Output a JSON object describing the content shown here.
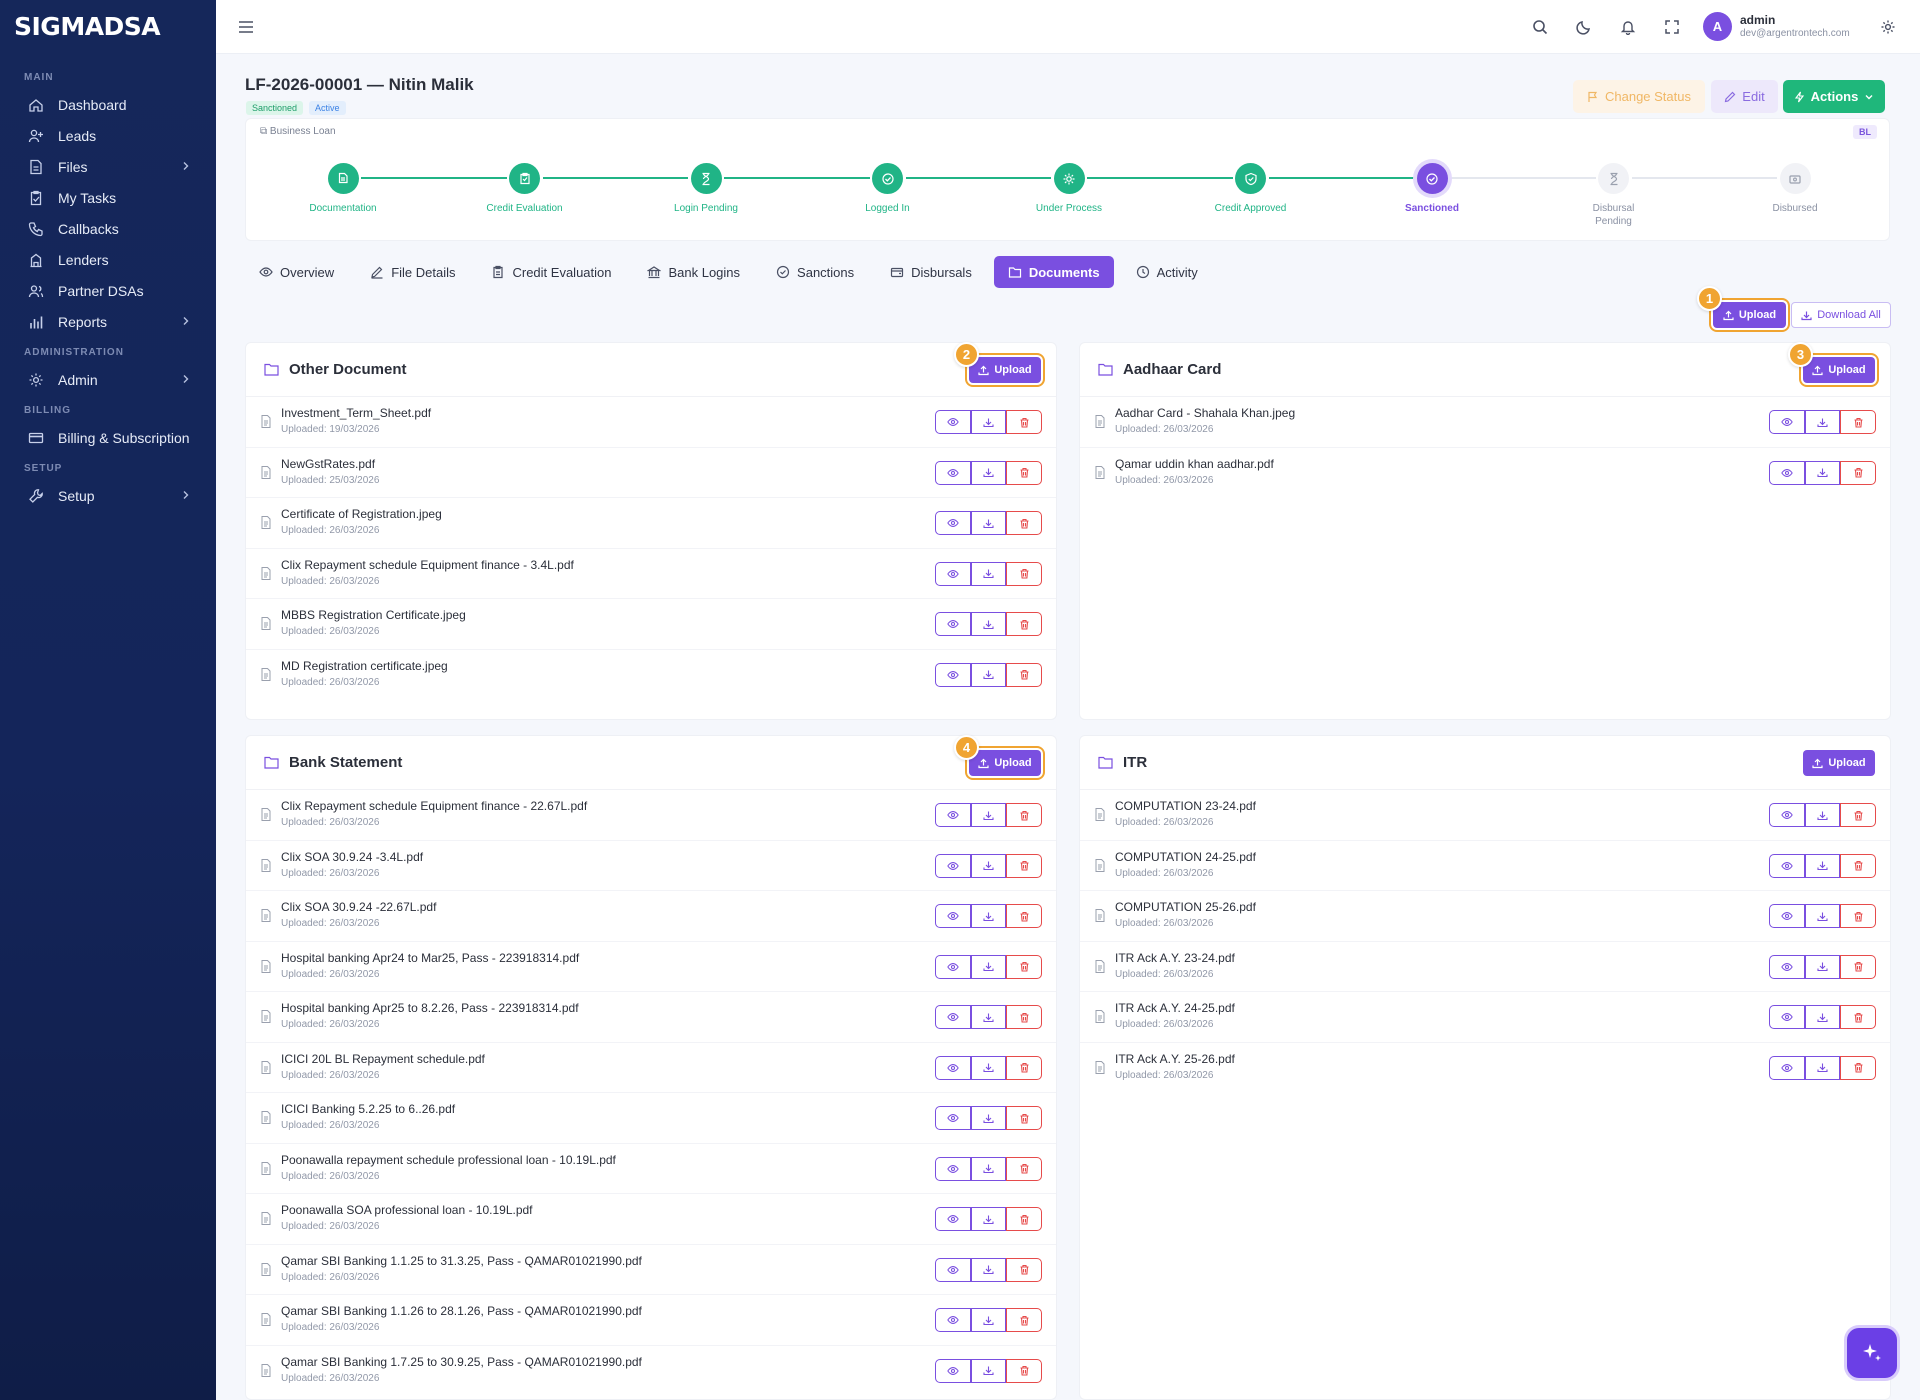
{
  "sidebar": {
    "brand": "SIGMADSA",
    "sections": [
      {
        "title": "MAIN",
        "items": [
          {
            "label": "Dashboard",
            "icon": "home-icon",
            "chevron": false
          },
          {
            "label": "Leads",
            "icon": "user-plus-icon",
            "chevron": false
          },
          {
            "label": "Files",
            "icon": "file-icon",
            "chevron": true
          },
          {
            "label": "My Tasks",
            "icon": "clipboard-check-icon",
            "chevron": false
          },
          {
            "label": "Callbacks",
            "icon": "phone-icon",
            "chevron": false
          },
          {
            "label": "Lenders",
            "icon": "building-icon",
            "chevron": false
          },
          {
            "label": "Partner DSAs",
            "icon": "users-icon",
            "chevron": false
          },
          {
            "label": "Reports",
            "icon": "bar-chart-icon",
            "chevron": true
          }
        ]
      },
      {
        "title": "ADMINISTRATION",
        "items": [
          {
            "label": "Admin",
            "icon": "gear-icon",
            "chevron": true
          }
        ]
      },
      {
        "title": "BILLING",
        "items": [
          {
            "label": "Billing & Subscription",
            "icon": "credit-card-icon",
            "chevron": false
          }
        ]
      },
      {
        "title": "SETUP",
        "items": [
          {
            "label": "Setup",
            "icon": "wrench-icon",
            "chevron": true
          }
        ]
      }
    ]
  },
  "user": {
    "initial": "A",
    "name": "admin",
    "email": "dev@argentrontech.com"
  },
  "header": {
    "title": "LF-2026-00001 — Nitin Malik",
    "status_badge": "Sanctioned",
    "state_badge": "Active",
    "change_status_label": "Change Status",
    "edit_label": "Edit",
    "actions_label": "Actions"
  },
  "loan": {
    "type": "Business Loan",
    "tag": "BL"
  },
  "steps": [
    {
      "label": "Documentation",
      "state": "done"
    },
    {
      "label": "Credit Evaluation",
      "state": "done"
    },
    {
      "label": "Login Pending",
      "state": "done"
    },
    {
      "label": "Logged In",
      "state": "done"
    },
    {
      "label": "Under Process",
      "state": "done"
    },
    {
      "label": "Credit Approved",
      "state": "done"
    },
    {
      "label": "Sanctioned",
      "state": "current"
    },
    {
      "label": "Disbursal Pending",
      "state": "todo"
    },
    {
      "label": "Disbursed",
      "state": "todo"
    }
  ],
  "tabs": [
    {
      "label": "Overview",
      "icon": "eye-icon"
    },
    {
      "label": "File Details",
      "icon": "edit-icon"
    },
    {
      "label": "Credit Evaluation",
      "icon": "clipboard-icon"
    },
    {
      "label": "Bank Logins",
      "icon": "bank-icon"
    },
    {
      "label": "Sanctions",
      "icon": "check-circle-icon"
    },
    {
      "label": "Disbursals",
      "icon": "wallet-icon"
    },
    {
      "label": "Documents",
      "icon": "folder-icon",
      "active": true
    },
    {
      "label": "Activity",
      "icon": "clock-icon"
    }
  ],
  "toolbar": {
    "upload_label": "Upload",
    "download_all_label": "Download All"
  },
  "markers": [
    "1",
    "2",
    "3",
    "4"
  ],
  "colors": {
    "accent": "#7a4fe0",
    "success": "#1fb77b",
    "warning": "#f0a431",
    "danger": "#e64b4b",
    "sidebar": "#15275a"
  },
  "doc_groups": [
    {
      "title": "Other Document",
      "upload_label": "Upload",
      "files": [
        {
          "name": "Investment_Term_Sheet.pdf",
          "date": "Uploaded: 19/03/2026"
        },
        {
          "name": "NewGstRates.pdf",
          "date": "Uploaded: 25/03/2026"
        },
        {
          "name": "Certificate of Registration.jpeg",
          "date": "Uploaded: 26/03/2026"
        },
        {
          "name": "Clix Repayment schedule Equipment finance - 3.4L.pdf",
          "date": "Uploaded: 26/03/2026"
        },
        {
          "name": "MBBS Registration Certificate.jpeg",
          "date": "Uploaded: 26/03/2026"
        },
        {
          "name": "MD Registration certificate.jpeg",
          "date": "Uploaded: 26/03/2026"
        }
      ]
    },
    {
      "title": "Aadhaar Card",
      "upload_label": "Upload",
      "files": [
        {
          "name": "Aadhar Card - Shahala Khan.jpeg",
          "date": "Uploaded: 26/03/2026"
        },
        {
          "name": "Qamar uddin khan aadhar.pdf",
          "date": "Uploaded: 26/03/2026"
        }
      ]
    },
    {
      "title": "Bank Statement",
      "upload_label": "Upload",
      "files": [
        {
          "name": "Clix Repayment schedule Equipment finance - 22.67L.pdf",
          "date": "Uploaded: 26/03/2026"
        },
        {
          "name": "Clix SOA 30.9.24 -3.4L.pdf",
          "date": "Uploaded: 26/03/2026"
        },
        {
          "name": "Clix SOA 30.9.24 -22.67L.pdf",
          "date": "Uploaded: 26/03/2026"
        },
        {
          "name": "Hospital banking Apr24 to Mar25, Pass - 223918314.pdf",
          "date": "Uploaded: 26/03/2026"
        },
        {
          "name": "Hospital banking Apr25 to 8.2.26, Pass - 223918314.pdf",
          "date": "Uploaded: 26/03/2026"
        },
        {
          "name": "ICICI 20L BL Repayment schedule.pdf",
          "date": "Uploaded: 26/03/2026"
        },
        {
          "name": "ICICI Banking 5.2.25 to 6..26.pdf",
          "date": "Uploaded: 26/03/2026"
        },
        {
          "name": "Poonawalla repayment schedule professional loan - 10.19L.pdf",
          "date": "Uploaded: 26/03/2026"
        },
        {
          "name": "Poonawalla SOA professional loan - 10.19L.pdf",
          "date": "Uploaded: 26/03/2026"
        },
        {
          "name": "Qamar SBI Banking 1.1.25 to 31.3.25, Pass - QAMAR01021990.pdf",
          "date": "Uploaded: 26/03/2026"
        },
        {
          "name": "Qamar SBI Banking 1.1.26 to 28.1.26, Pass - QAMAR01021990.pdf",
          "date": "Uploaded: 26/03/2026"
        },
        {
          "name": "Qamar SBI Banking 1.7.25 to 30.9.25, Pass - QAMAR01021990.pdf",
          "date": "Uploaded: 26/03/2026"
        }
      ]
    },
    {
      "title": "ITR",
      "upload_label": "Upload",
      "files": [
        {
          "name": "COMPUTATION 23-24.pdf",
          "date": "Uploaded: 26/03/2026"
        },
        {
          "name": "COMPUTATION 24-25.pdf",
          "date": "Uploaded: 26/03/2026"
        },
        {
          "name": "COMPUTATION 25-26.pdf",
          "date": "Uploaded: 26/03/2026"
        },
        {
          "name": "ITR Ack A.Y. 23-24.pdf",
          "date": "Uploaded: 26/03/2026"
        },
        {
          "name": "ITR Ack A.Y. 24-25.pdf",
          "date": "Uploaded: 26/03/2026"
        },
        {
          "name": "ITR Ack A.Y. 25-26.pdf",
          "date": "Uploaded: 26/03/2026"
        }
      ]
    }
  ]
}
